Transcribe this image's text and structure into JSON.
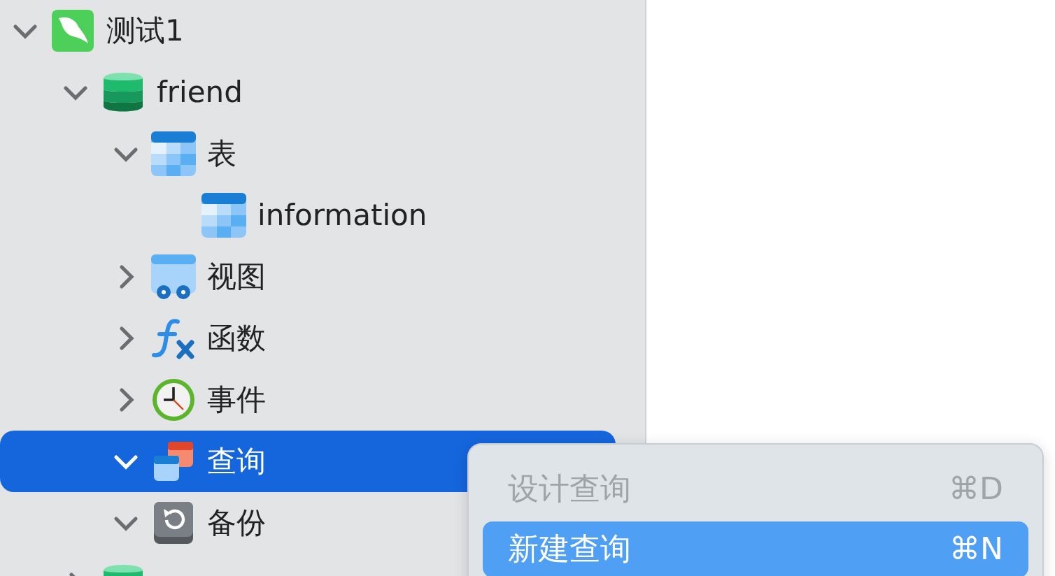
{
  "tree": [
    {
      "label": "测试1",
      "kind": "connection",
      "expanded": true,
      "selected": false,
      "children": [
        {
          "label": "friend",
          "kind": "database",
          "expanded": true,
          "selected": false,
          "children": [
            {
              "label": "表",
              "kind": "tables",
              "expanded": true,
              "selected": false,
              "children": [
                {
                  "label": "information",
                  "kind": "table",
                  "selected": false
                }
              ]
            },
            {
              "label": "视图",
              "kind": "views",
              "expanded": false,
              "selected": false
            },
            {
              "label": "函数",
              "kind": "functions",
              "expanded": false,
              "selected": false
            },
            {
              "label": "事件",
              "kind": "events",
              "expanded": false,
              "selected": false
            },
            {
              "label": "查询",
              "kind": "queries",
              "expanded": true,
              "selected": true
            },
            {
              "label": "备份",
              "kind": "backups",
              "expanded": true,
              "selected": false
            }
          ]
        },
        {
          "kind": "database",
          "expanded": false,
          "selected": false
        }
      ]
    }
  ],
  "context_menu": {
    "items": [
      {
        "label": "设计查询",
        "shortcut": "⌘D",
        "disabled": true,
        "selected": false
      },
      {
        "label": "新建查询",
        "shortcut": "⌘N",
        "disabled": false,
        "selected": true
      }
    ]
  }
}
